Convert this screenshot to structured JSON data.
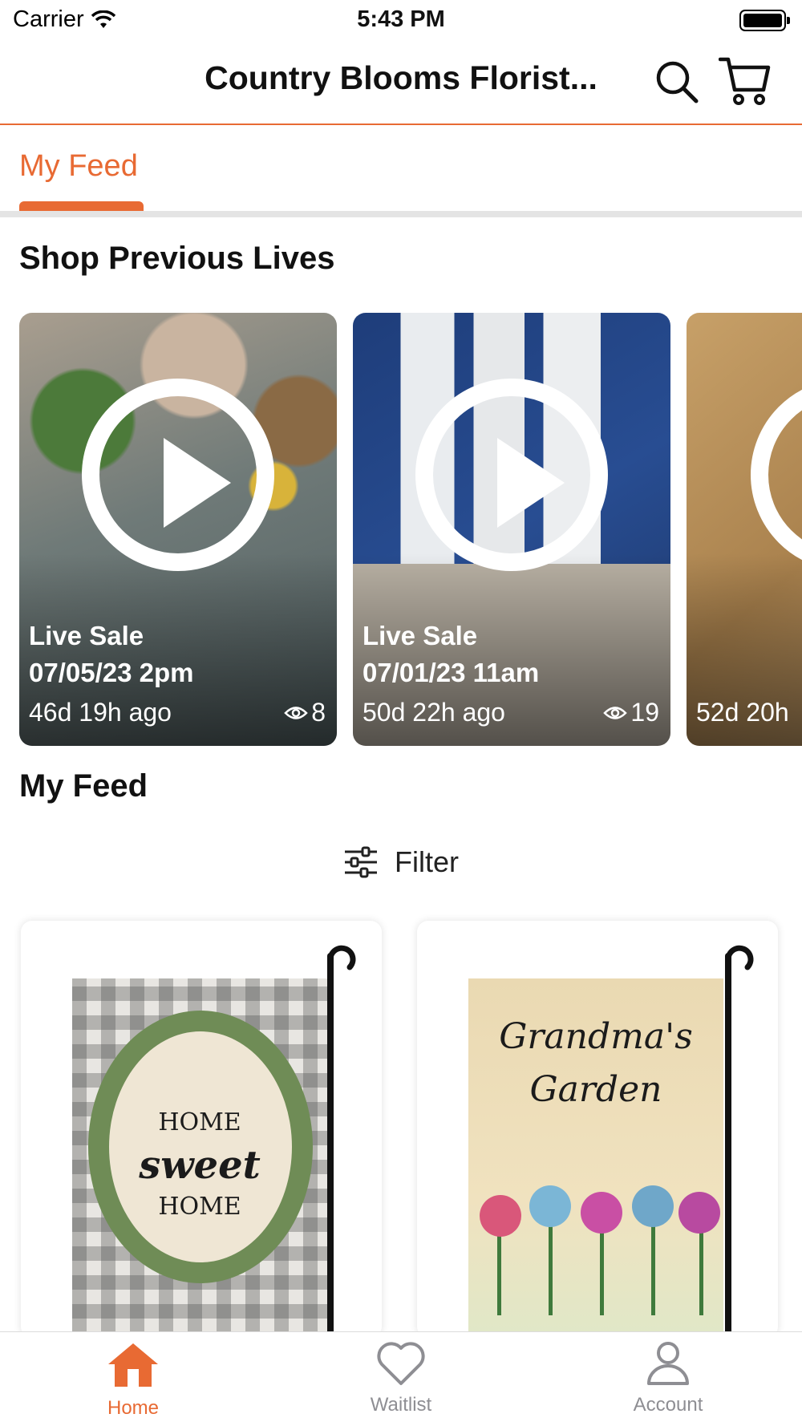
{
  "status_bar": {
    "carrier": "Carrier",
    "time": "5:43 PM"
  },
  "header": {
    "title": "Country Blooms Florist...",
    "icons": [
      "search-icon",
      "cart-icon"
    ]
  },
  "tabs": [
    {
      "label": "My Feed",
      "active": true
    }
  ],
  "sections": {
    "previous_lives": "Shop Previous Lives",
    "feed": "My Feed"
  },
  "lives": [
    {
      "label": "Live Sale",
      "date": "07/05/23 2pm",
      "ago": "46d 19h ago",
      "views": "8"
    },
    {
      "label": "Live Sale",
      "date": "07/01/23 11am",
      "ago": "50d 22h ago",
      "views": "19"
    },
    {
      "label": "",
      "date": "",
      "ago": "52d 20h",
      "views": ""
    }
  ],
  "filter": {
    "label": "Filter",
    "icon": "sliders-icon"
  },
  "products": [
    {
      "artwork_text": [
        "HOME",
        "sweet",
        "HOME"
      ]
    },
    {
      "artwork_text": [
        "Grandma's",
        "Garden"
      ]
    }
  ],
  "tab_bar": [
    {
      "label": "Home",
      "icon": "home-icon",
      "active": true
    },
    {
      "label": "Waitlist",
      "icon": "heart-icon",
      "active": false
    },
    {
      "label": "Account",
      "icon": "person-icon",
      "active": false
    }
  ],
  "colors": {
    "accent": "#e86a33",
    "inactive": "#8e8e93",
    "divider": "#e4e4e4"
  }
}
